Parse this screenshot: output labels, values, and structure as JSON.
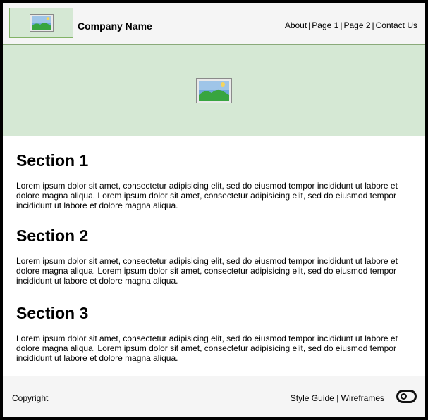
{
  "header": {
    "logo_icon": "image-placeholder-icon",
    "company_name": "Company Name",
    "nav": [
      {
        "label": "About"
      },
      {
        "label": "Page 1"
      },
      {
        "label": "Page 2"
      },
      {
        "label": "Contact Us"
      }
    ],
    "nav_separator": "|"
  },
  "hero": {
    "icon": "image-placeholder-icon"
  },
  "sections": [
    {
      "title": "Section 1",
      "body": "Lorem ipsum dolor sit amet, consectetur adipisicing elit, sed do eiusmod tempor incididunt ut labore et dolore magna aliqua. Lorem ipsum dolor sit amet, consectetur adipisicing elit, sed do eiusmod tempor incididunt ut labore et dolore magna aliqua."
    },
    {
      "title": "Section 2",
      "body": "Lorem ipsum dolor sit amet, consectetur adipisicing elit, sed do eiusmod tempor incididunt ut labore et dolore magna aliqua. Lorem ipsum dolor sit amet, consectetur adipisicing elit, sed do eiusmod tempor incididunt ut labore et dolore magna aliqua."
    },
    {
      "title": "Section 3",
      "body": "Lorem ipsum dolor sit amet, consectetur adipisicing elit, sed do eiusmod tempor incididunt ut labore et dolore magna aliqua. Lorem ipsum dolor sit amet, consectetur adipisicing elit, sed do eiusmod tempor incididunt ut labore et dolore magna aliqua."
    }
  ],
  "footer": {
    "copyright": "Copyright",
    "links": [
      {
        "label": "Style Guide"
      },
      {
        "label": "Wireframes"
      }
    ],
    "link_separator": "|",
    "toggle_icon": "toggle-icon"
  },
  "colors": {
    "placeholder_fill": "#d5e8d4",
    "placeholder_border": "#82b366",
    "bar_background": "#f5f5f5"
  }
}
